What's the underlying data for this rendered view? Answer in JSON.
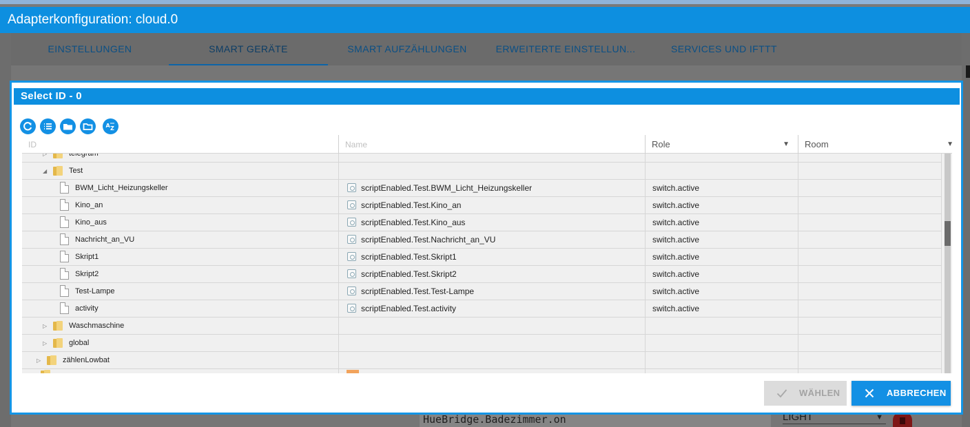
{
  "window": {
    "title": "Adapterkonfiguration: cloud.0"
  },
  "tabs": [
    {
      "label": "EINSTELLUNGEN"
    },
    {
      "label": "SMART GERÄTE"
    },
    {
      "label": "SMART AUFZÄHLUNGEN"
    },
    {
      "label": "ERWEITERTE EINSTELLUN..."
    },
    {
      "label": "SERVICES UND IFTTT"
    }
  ],
  "active_tab": "SMART GERÄTE",
  "background": {
    "field_value": "HueBridge.Badezimmer.on",
    "type_value": "LIGHT"
  },
  "dialog": {
    "title": "Select ID - 0",
    "toolbar_icons": [
      "refresh-icon",
      "list-icon",
      "folder-filled-icon",
      "folder-outline-icon",
      "sort-az-icon"
    ],
    "columns": {
      "id": "ID",
      "name": "Name",
      "role": "Role",
      "room": "Room"
    },
    "rows": [
      {
        "id": "telegram",
        "name": "",
        "role": ""
      },
      {
        "id": "Test",
        "name": "",
        "role": ""
      },
      {
        "id": "BWM_Licht_Heizungskeller",
        "name": "scriptEnabled.Test.BWM_Licht_Heizungskeller",
        "role": "switch.active"
      },
      {
        "id": "Kino_an",
        "name": "scriptEnabled.Test.Kino_an",
        "role": "switch.active"
      },
      {
        "id": "Kino_aus",
        "name": "scriptEnabled.Test.Kino_aus",
        "role": "switch.active"
      },
      {
        "id": "Nachricht_an_VU",
        "name": "scriptEnabled.Test.Nachricht_an_VU",
        "role": "switch.active"
      },
      {
        "id": "Skript1",
        "name": "scriptEnabled.Test.Skript1",
        "role": "switch.active"
      },
      {
        "id": "Skript2",
        "name": "scriptEnabled.Test.Skript2",
        "role": "switch.active"
      },
      {
        "id": "Test-Lampe",
        "name": "scriptEnabled.Test.Test-Lampe",
        "role": "switch.active"
      },
      {
        "id": "activity",
        "name": "scriptEnabled.Test.activity",
        "role": "switch.active"
      },
      {
        "id": "Waschmaschine",
        "name": "",
        "role": ""
      },
      {
        "id": "global",
        "name": "",
        "role": ""
      },
      {
        "id": "zählenLowbat",
        "name": "",
        "role": ""
      }
    ],
    "buttons": {
      "select": "WÄHLEN",
      "cancel": "ABBRECHEN"
    }
  }
}
